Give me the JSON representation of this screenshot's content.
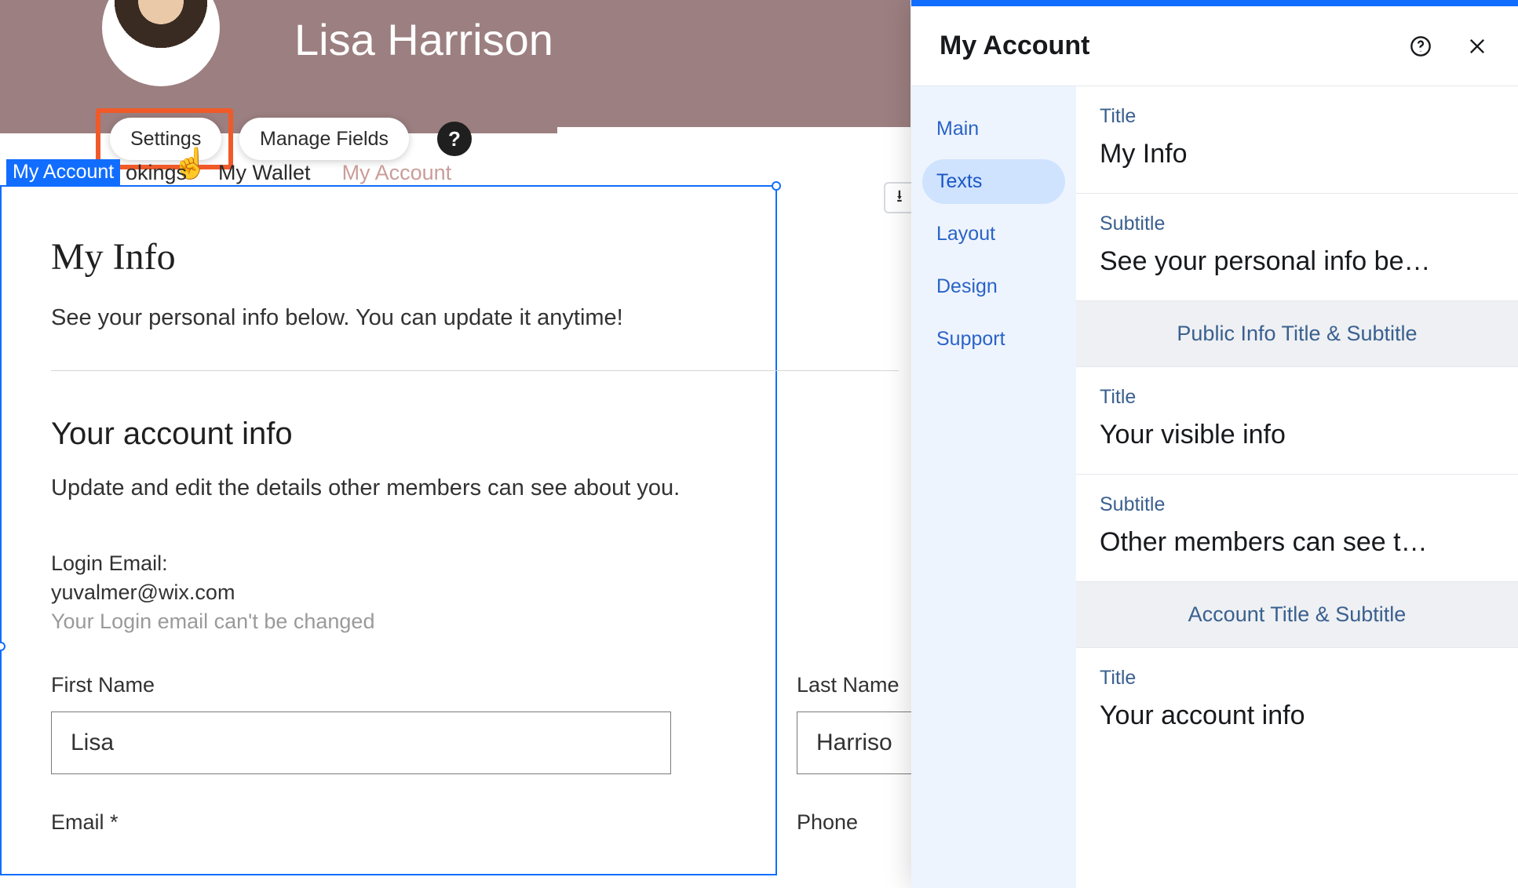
{
  "profile": {
    "display_name": "Lisa Harrison"
  },
  "toolbar": {
    "settings_label": "Settings",
    "manage_fields_label": "Manage Fields",
    "help_glyph": "?"
  },
  "tabs": {
    "selection_label": "My Account",
    "items": [
      "okings",
      "My Wallet",
      "My Account"
    ]
  },
  "page": {
    "title": "My Info",
    "subtitle": "See your personal info below. You can update it anytime!",
    "account_title": "Your account info",
    "account_subtitle": "Update and edit the details other members can see about you.",
    "login_email_label": "Login Email:",
    "login_email_value": "yuvalmer@wix.com",
    "login_email_note": "Your Login email can't be changed",
    "first_name_label": "First Name",
    "first_name_value": "Lisa",
    "last_name_label": "Last Name",
    "last_name_value": "Harriso",
    "email_label": "Email *",
    "phone_label": "Phone"
  },
  "download_glyph": "⭳",
  "panel": {
    "title": "My Account",
    "nav": {
      "main": "Main",
      "texts": "Texts",
      "layout": "Layout",
      "design": "Design",
      "support": "Support"
    },
    "groups": {
      "title_label": "Title",
      "title_value": "My Info",
      "subtitle_label": "Subtitle",
      "subtitle_value": "See your personal info be…",
      "section_public": "Public Info Title & Subtitle",
      "public_title_label": "Title",
      "public_title_value": "Your visible info",
      "public_subtitle_label": "Subtitle",
      "public_subtitle_value": "Other members can see t…",
      "section_account": "Account Title & Subtitle",
      "account_title_label": "Title",
      "account_title_value": "Your account info"
    }
  }
}
